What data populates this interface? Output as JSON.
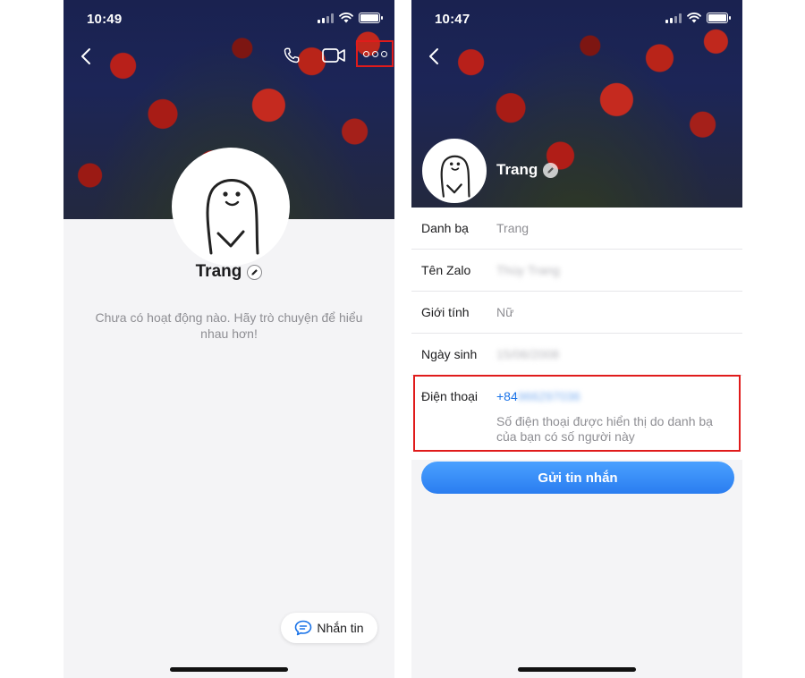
{
  "left_screen": {
    "status_time": "10:49",
    "profile_name": "Trang",
    "empty_activity_text": "Chưa có hoạt động nào. Hãy trò chuyện để hiểu nhau hơn!",
    "message_button_label": "Nhắn tin"
  },
  "right_screen": {
    "status_time": "10:47",
    "profile_name": "Trang",
    "info_rows": [
      {
        "label": "Danh bạ",
        "value": "Trang"
      },
      {
        "label": "Tên Zalo",
        "value": "Thùy Trang"
      },
      {
        "label": "Giới tính",
        "value": "Nữ"
      },
      {
        "label": "Ngày sinh",
        "value": "15/06/2008"
      }
    ],
    "phone": {
      "label": "Điện thoại",
      "country_code": "+84",
      "number_hidden": "966297036",
      "note": "Số điện thoại được hiển thị do danh bạ của bạn có số người này"
    },
    "send_button_label": "Gửi tin nhắn"
  },
  "colors": {
    "highlight": "#e01b1b",
    "accent_blue": "#2a7df0",
    "link_blue": "#1a73e8"
  }
}
